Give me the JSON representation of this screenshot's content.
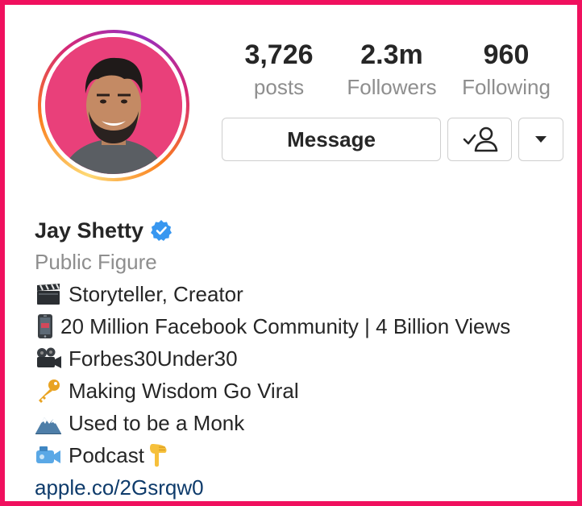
{
  "profile": {
    "name": "Jay Shetty",
    "category": "Public Figure",
    "verified": true,
    "accent_ring_colors": [
      "#feda75",
      "#fa7e1e",
      "#d62976",
      "#962fbf"
    ]
  },
  "stats": [
    {
      "value": "3,726",
      "label": "posts"
    },
    {
      "value": "2.3m",
      "label": "Followers"
    },
    {
      "value": "960",
      "label": "Following"
    }
  ],
  "actions": {
    "message_label": "Message",
    "follow_icon": "person-check-icon",
    "more_icon": "caret-down-icon"
  },
  "bio": {
    "lines": [
      {
        "icon": "clapperboard-icon",
        "text": "Storyteller, Creator"
      },
      {
        "icon": "mobile-phone-icon",
        "text": "20 Million Facebook Community | 4 Billion Views"
      },
      {
        "icon": "movie-camera-icon",
        "text": "Forbes30Under30"
      },
      {
        "icon": "key-icon",
        "text": "Making Wisdom Go Viral"
      },
      {
        "icon": "snow-mountain-icon",
        "text": "Used to be a Monk"
      },
      {
        "icon": "video-camera-icon",
        "text": "Podcast",
        "trailing_icon": "pointing-down-icon"
      }
    ],
    "link": "apple.co/2Gsrqw0"
  },
  "colors": {
    "frame": "#f0105e",
    "link": "#0e3b6b",
    "secondary_text": "#8e8e8e",
    "verified": "#3897f0"
  }
}
